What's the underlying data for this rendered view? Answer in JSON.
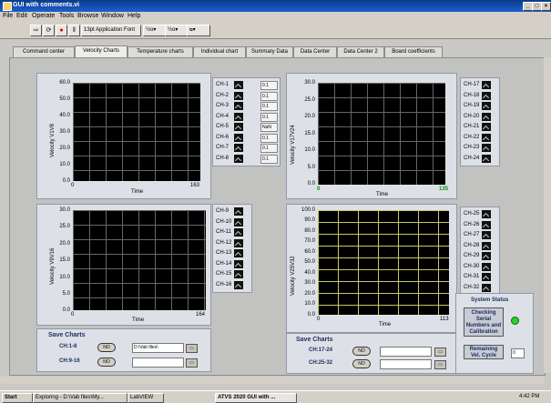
{
  "window": {
    "title": "GUI with comments.vi"
  },
  "menu": [
    "File",
    "Edit",
    "Operate",
    "Tools",
    "Browse",
    "Window",
    "Help"
  ],
  "toolbar": {
    "font": "13pt Application Font",
    "align": "½o▾",
    "distribute": "½o▾",
    "reorder": "ᴓ▾"
  },
  "tabs": [
    "Command center",
    "Velocity Charts",
    "Temperature charts",
    "Individual chart",
    "Summary Data",
    "Data Center",
    "Data Center 2",
    "Board coefficients"
  ],
  "charts": [
    {
      "ylabel": "Velocity V1V8",
      "xlabel": "Time",
      "yticks": [
        "60.0",
        "50.0",
        "40.0",
        "30.0",
        "20.0",
        "10.0",
        "0.0"
      ],
      "xmin": "0",
      "xmax": "163"
    },
    {
      "ylabel": "Velocity V17V24",
      "xlabel": "Time",
      "yticks": [
        "30.0",
        "25.0",
        "20.0",
        "15.0",
        "10.0",
        "5.0",
        "0.0"
      ],
      "xmin": "0",
      "xmax": "135"
    },
    {
      "ylabel": "Velocity V9V16",
      "xlabel": "Time",
      "yticks": [
        "30.0",
        "25.0",
        "20.0",
        "15.0",
        "10.0",
        "5.0",
        "0.0"
      ],
      "xmin": "0",
      "xmax": "164"
    },
    {
      "ylabel": "Velocity V25V32",
      "xlabel": "Time",
      "yticks": [
        "100.0",
        "90.0",
        "80.0",
        "70.0",
        "60.0",
        "50.0",
        "40.0",
        "30.0",
        "20.0",
        "10.0",
        "0.0"
      ],
      "xmin": "0",
      "xmax": "113"
    }
  ],
  "channels1": [
    "CH-1",
    "CH-2",
    "CH-3",
    "CH-4",
    "CH-5",
    "CH-6",
    "CH-7",
    "CH-8"
  ],
  "channels1_values": [
    "0.1",
    "0.1",
    "0.1",
    "0.1",
    "NaN",
    "0.1",
    "0.1",
    "0.1"
  ],
  "channels2": [
    "CH-9",
    "CH-10",
    "CH-11",
    "CH-12",
    "CH-13",
    "CH-14",
    "CH-15",
    "CH-16"
  ],
  "channels3": [
    "CH-17",
    "CH-18",
    "CH-19",
    "CH-20",
    "CH-21",
    "CH-22",
    "CH-23",
    "CH-24"
  ],
  "channels4": [
    "CH-25",
    "CH-26",
    "CH-27",
    "CH-28",
    "CH-29",
    "CH-30",
    "CH-31",
    "CH-32"
  ],
  "save_left": {
    "title": "Save Charts",
    "row1_label": "CH:1-8",
    "row2_label": "CH:9-16",
    "btn": "NO",
    "path1": "D:\\Vab files\\",
    "path2": ""
  },
  "save_right": {
    "title": "Save Charts",
    "row1_label": "CH:17-24",
    "row2_label": "CH:25-32",
    "btn": "NO",
    "path1": "",
    "path2": ""
  },
  "system_status": {
    "title": "System Status",
    "checking": "Checking Serial Numbers and Calibration",
    "remaining": "Remaining Vel. Cycle",
    "remaining_value": "0"
  },
  "taskbar": {
    "start": "Start",
    "task1": "Exploring - D:\\Vab files\\My...",
    "task2": "LabVIEW",
    "task3": "ATVS 2020 GUI with ...",
    "clock": "4:42 PM"
  }
}
